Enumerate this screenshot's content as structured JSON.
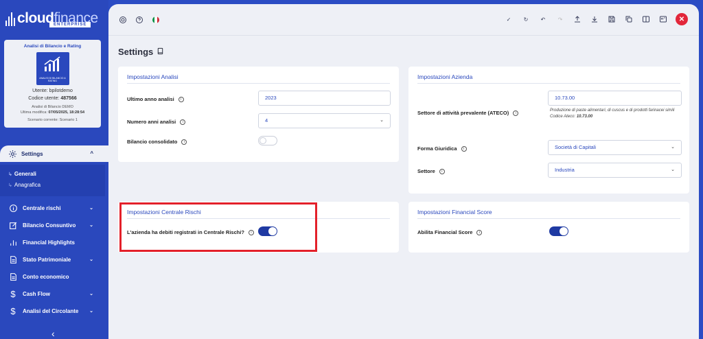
{
  "brand": {
    "name_bold": "cloud",
    "name_light": "finance",
    "edition": "ENTERPRISE"
  },
  "user_card": {
    "title": "Analisi di Bilancio e Rating",
    "logo_text": "ANALISI DI BILANCIO & RATING",
    "user_line": "Utente: bpilotdemo",
    "code_label": "Codice utente:",
    "code_value": "487566",
    "analysis": "Analisi di Bilancio DEMO",
    "last_mod_label": "Ultima modifica:",
    "last_mod_value": "07/05/2025, 18:28:54",
    "scenario": "Scenario corrente: Scenario 1"
  },
  "sidebar": {
    "settings_label": "Settings",
    "sub_items": [
      "Generali",
      "Anagrafica"
    ],
    "items": [
      {
        "label": "Centrale rischi",
        "icon": "info-circle-icon",
        "has_caret": true
      },
      {
        "label": "Bilancio Consuntivo",
        "icon": "edit-icon",
        "has_caret": true
      },
      {
        "label": "Financial Highlights",
        "icon": "bar-chart-icon",
        "has_caret": false
      },
      {
        "label": "Stato Patrimoniale",
        "icon": "document-icon",
        "has_caret": true
      },
      {
        "label": "Conto economico",
        "icon": "document-icon",
        "has_caret": false
      },
      {
        "label": "Cash Flow",
        "icon": "dollar-icon",
        "has_caret": true
      },
      {
        "label": "Analisi del Circolante",
        "icon": "dollar-icon",
        "has_caret": true
      }
    ]
  },
  "page": {
    "title": "Settings"
  },
  "analisi": {
    "title": "Impostazioni Analisi",
    "ultimo_anno_label": "Ultimo anno analisi",
    "ultimo_anno_value": "2023",
    "numero_anni_label": "Numero anni analisi",
    "numero_anni_value": "4",
    "consolidato_label": "Bilancio consolidato",
    "consolidato_on": false
  },
  "azienda": {
    "title": "Impostazioni Azienda",
    "ateco_label": "Settore di attività prevalente (ATECO)",
    "ateco_value": "10.73.00",
    "ateco_desc": "Produzione di paste alimentari, di cuscus e di prodotti farinacei simili",
    "ateco_code_label": "Codice Ateco:",
    "ateco_code_value": "10.73.00",
    "forma_label": "Forma Giuridica",
    "forma_value": "Società di Capitali",
    "settore_label": "Settore",
    "settore_value": "Industria"
  },
  "centrale": {
    "title": "Impostazioni Centrale Rischi",
    "debiti_label": "L'azienda ha debiti registrati in Centrale Rischi?",
    "debiti_on": true
  },
  "financial": {
    "title": "Impostazioni Financial Score",
    "abilita_label": "Abilita Financial Score",
    "abilita_on": true
  },
  "colors": {
    "primary": "#2a48bd",
    "toggle_on": "#1f3aa3",
    "close": "#e2263a",
    "highlight": "#e3202a"
  }
}
